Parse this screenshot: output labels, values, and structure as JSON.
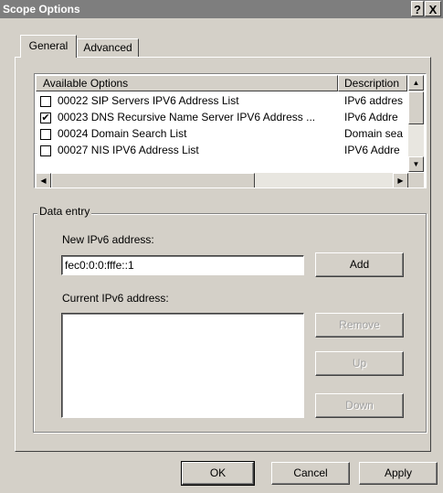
{
  "window": {
    "title": "Scope Options",
    "help_glyph": "?",
    "close_glyph": "X"
  },
  "tabs": [
    {
      "label": "General",
      "active": true
    },
    {
      "label": "Advanced",
      "active": false
    }
  ],
  "options_list": {
    "columns": [
      "Available Options",
      "Description"
    ],
    "rows": [
      {
        "checked": false,
        "name": "00022 SIP Servers IPV6 Address List",
        "description": "IPv6 addres"
      },
      {
        "checked": true,
        "name": "00023 DNS Recursive Name Server IPV6 Address ...",
        "description": "IPv6 Addre"
      },
      {
        "checked": false,
        "name": "00024 Domain Search List",
        "description": "Domain sea"
      },
      {
        "checked": false,
        "name": "00027 NIS IPV6 Address List",
        "description": "IPV6 Addre"
      }
    ],
    "check_glyph": "✔",
    "scroll_up": "▲",
    "scroll_down": "▼",
    "scroll_left": "◀",
    "scroll_right": "▶"
  },
  "data_entry": {
    "group_label": "Data entry",
    "new_label": "New IPv6 address:",
    "new_value": "fec0:0:0:fffe::1",
    "add_label": "Add",
    "current_label": "Current IPv6 address:",
    "remove_label": "Remove",
    "up_label": "Up",
    "down_label": "Down"
  },
  "footer": {
    "ok_label": "OK",
    "cancel_label": "Cancel",
    "apply_label": "Apply"
  }
}
